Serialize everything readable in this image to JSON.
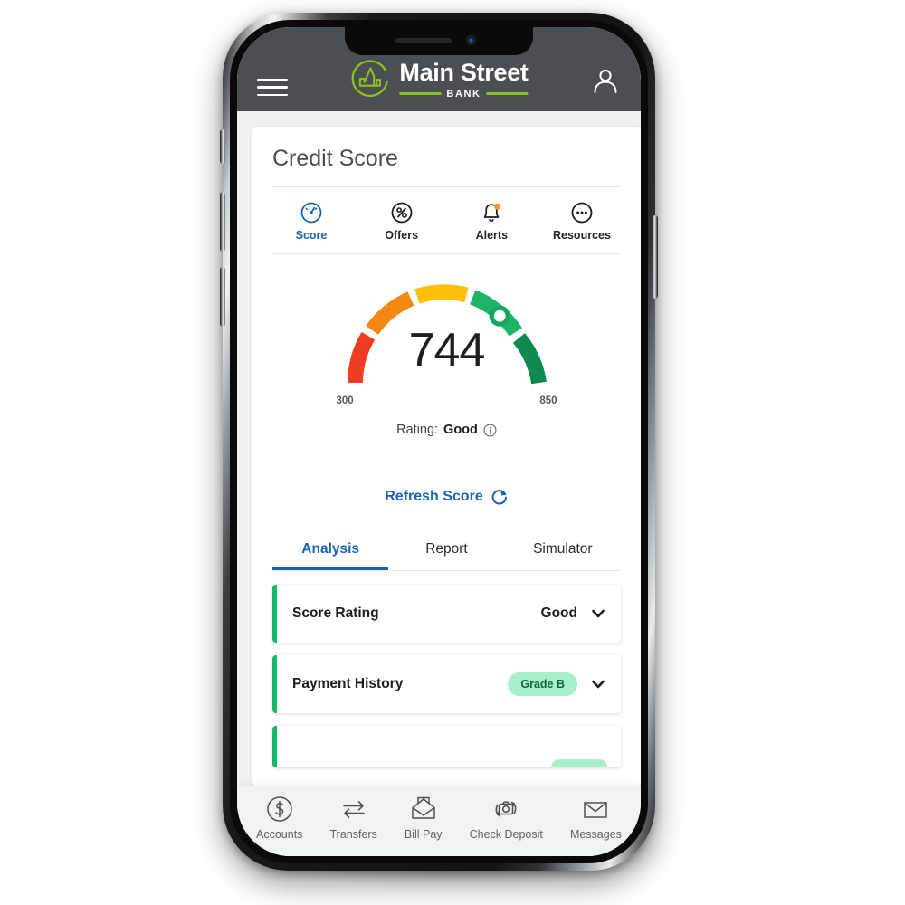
{
  "header": {
    "menu_icon": "hamburger-menu-icon",
    "brand_name": "Main Street",
    "brand_sub": "BANK",
    "logo_icon": "skyline-circle-logo-icon",
    "avatar_icon": "user-avatar-icon",
    "bg_color": "#4a4f52",
    "accent_green": "#8cc024"
  },
  "card": {
    "title": "Credit Score"
  },
  "section_nav": [
    {
      "label": "Score",
      "icon": "speedometer-icon",
      "active": true
    },
    {
      "label": "Offers",
      "icon": "percent-circle-icon",
      "active": false
    },
    {
      "label": "Alerts",
      "icon": "bell-icon",
      "active": false,
      "badge": true
    },
    {
      "label": "Resources",
      "icon": "ellipsis-circle-icon",
      "active": false
    }
  ],
  "gauge": {
    "score": "744",
    "min_label": "300",
    "max_label": "850",
    "min": 300,
    "max": 850,
    "value": 744,
    "segment_colors": [
      "#ef3d23",
      "#f68712",
      "#fbc00c",
      "#1db468",
      "#0f8a4e"
    ],
    "marker_color": "#13a762"
  },
  "rating": {
    "label": "Rating:",
    "value": "Good",
    "info_icon": "info-circle-icon"
  },
  "refresh": {
    "label": "Refresh Score",
    "icon": "refresh-circular-arrow-icon",
    "color": "#1c62b9"
  },
  "tabs": [
    {
      "label": "Analysis",
      "active": true
    },
    {
      "label": "Report",
      "active": false
    },
    {
      "label": "Simulator",
      "active": false
    }
  ],
  "accordions": [
    {
      "label": "Score Rating",
      "value": "Good",
      "badge": null,
      "chevron": "chevron-down-icon"
    },
    {
      "label": "Payment History",
      "value": null,
      "badge": "Grade B",
      "chevron": "chevron-down-icon"
    }
  ],
  "bottom_nav": [
    {
      "label": "Accounts",
      "icon": "dollar-circle-icon"
    },
    {
      "label": "Transfers",
      "icon": "transfer-arrows-icon"
    },
    {
      "label": "Bill Pay",
      "icon": "open-envelope-icon"
    },
    {
      "label": "Check Deposit",
      "icon": "camera-refresh-icon"
    },
    {
      "label": "Messages",
      "icon": "envelope-icon"
    }
  ]
}
